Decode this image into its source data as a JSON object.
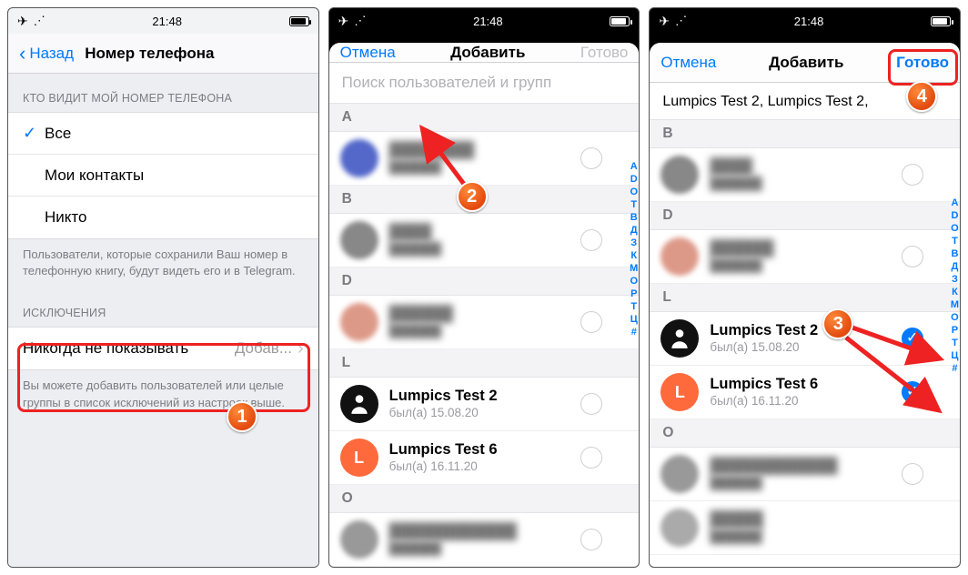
{
  "statusbar": {
    "time": "21:48"
  },
  "screen1": {
    "back": "Назад",
    "title": "Номер телефона",
    "whoHeader": "КТО ВИДИТ МОЙ НОМЕР ТЕЛЕФОНА",
    "opts": {
      "all": "Все",
      "contacts": "Мои контакты",
      "nobody": "Никто"
    },
    "whoFooter": "Пользователи, которые сохранили Ваш номер в телефонную книгу, будут видеть его и в Telegram.",
    "exHeader": "ИСКЛЮЧЕНИЯ",
    "never": "Никогда не показывать",
    "addValue": "Добав...",
    "exFooter": "Вы можете добавить пользователей или целые группы в список исключений из настроек выше."
  },
  "screen2": {
    "cancel": "Отмена",
    "title": "Добавить",
    "done": "Готово",
    "searchPlaceholder": "Поиск пользователей и групп",
    "sect": {
      "A": "A",
      "B": "B",
      "D": "D",
      "L": "L",
      "O": "O"
    },
    "lumpics2": {
      "name": "Lumpics Test 2",
      "sub": "был(а) 15.08.20"
    },
    "lumpics6": {
      "name": "Lumpics Test 6",
      "sub": "был(а) 16.11.20"
    }
  },
  "screen3": {
    "cancel": "Отмена",
    "title": "Добавить",
    "done": "Готово",
    "selectedChips": "Lumpics Test 2,  Lumpics Test 2,",
    "sect": {
      "B": "B",
      "D": "D",
      "L": "L",
      "O": "O"
    },
    "lumpics2": {
      "name": "Lumpics Test 2",
      "sub": "был(а) 15.08.20"
    },
    "lumpics6": {
      "name": "Lumpics Test 6",
      "sub": "был(а) 16.11.20"
    }
  },
  "indexLetters": [
    "A",
    "D",
    "O",
    "Т",
    "В",
    "Д",
    "З",
    "К",
    "М",
    "О",
    "Р",
    "Т",
    "Ц",
    "#"
  ],
  "colors": {
    "accent": "#007aff",
    "annot": "#e22"
  }
}
